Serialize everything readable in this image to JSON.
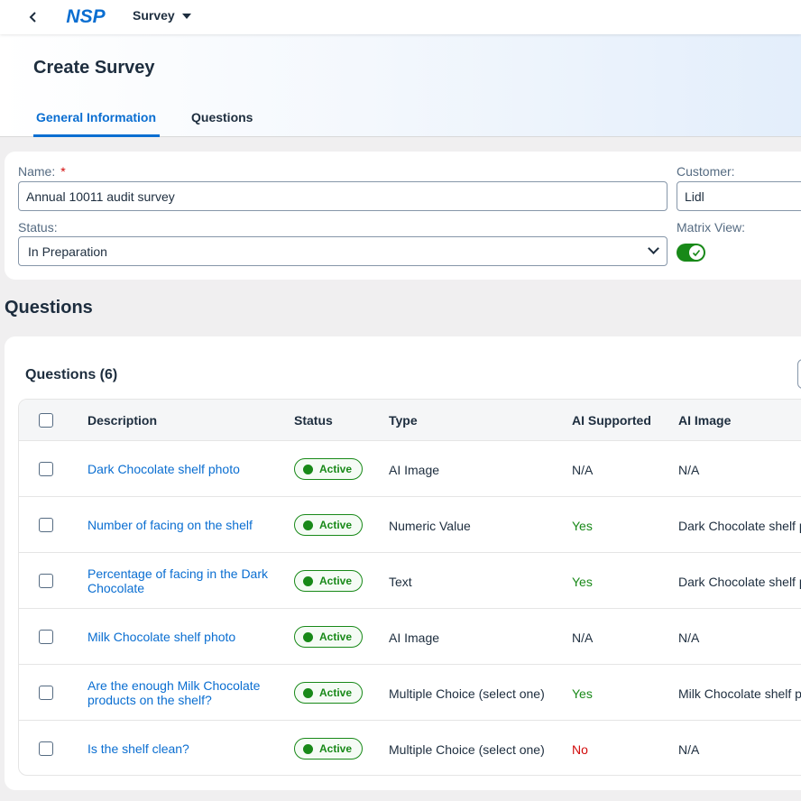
{
  "shell": {
    "app_title": "Survey",
    "logo_text": "NSP"
  },
  "header": {
    "title": "Create Survey",
    "tabs": [
      {
        "label": "General Information",
        "selected": true
      },
      {
        "label": "Questions",
        "selected": false
      }
    ]
  },
  "form": {
    "name_label": "Name:",
    "required_mark": "*",
    "name_value": "Annual 10011 audit survey",
    "customer_label": "Customer:",
    "customer_value": "Lidl",
    "status_label": "Status:",
    "status_value": "In Preparation",
    "matrix_label": "Matrix View:",
    "matrix_on": true
  },
  "section_title": "Questions",
  "table": {
    "title": "Questions (6)",
    "columns": [
      "Description",
      "Status",
      "Type",
      "AI Supported",
      "AI Image"
    ],
    "rows": [
      {
        "description": "Dark Chocolate shelf photo",
        "status": "Active",
        "type": "AI Image",
        "ai_supported": "N/A",
        "ai_image": "N/A"
      },
      {
        "description": "Number of facing on the shelf",
        "status": "Active",
        "type": "Numeric Value",
        "ai_supported": "Yes",
        "ai_image": "Dark Chocolate shelf p"
      },
      {
        "description": "Percentage of facing in the Dark Chocolate",
        "status": "Active",
        "type": "Text",
        "ai_supported": "Yes",
        "ai_image": "Dark Chocolate shelf p"
      },
      {
        "description": "Milk Chocolate shelf photo",
        "status": "Active",
        "type": "AI Image",
        "ai_supported": "N/A",
        "ai_image": "N/A"
      },
      {
        "description": "Are the enough Milk Chocolate products on the shelf?",
        "status": "Active",
        "type": "Multiple Choice (select one)",
        "ai_supported": "Yes",
        "ai_image": "Milk Chocolate shelf p"
      },
      {
        "description": "Is the shelf clean?",
        "status": "Active",
        "type": "Multiple Choice (select one)",
        "ai_supported": "No",
        "ai_image": "N/A"
      }
    ]
  },
  "colors": {
    "accent": "#0a6ed1",
    "positive": "#188918",
    "negative": "#d20a0a",
    "text": "#1d2d3e"
  }
}
